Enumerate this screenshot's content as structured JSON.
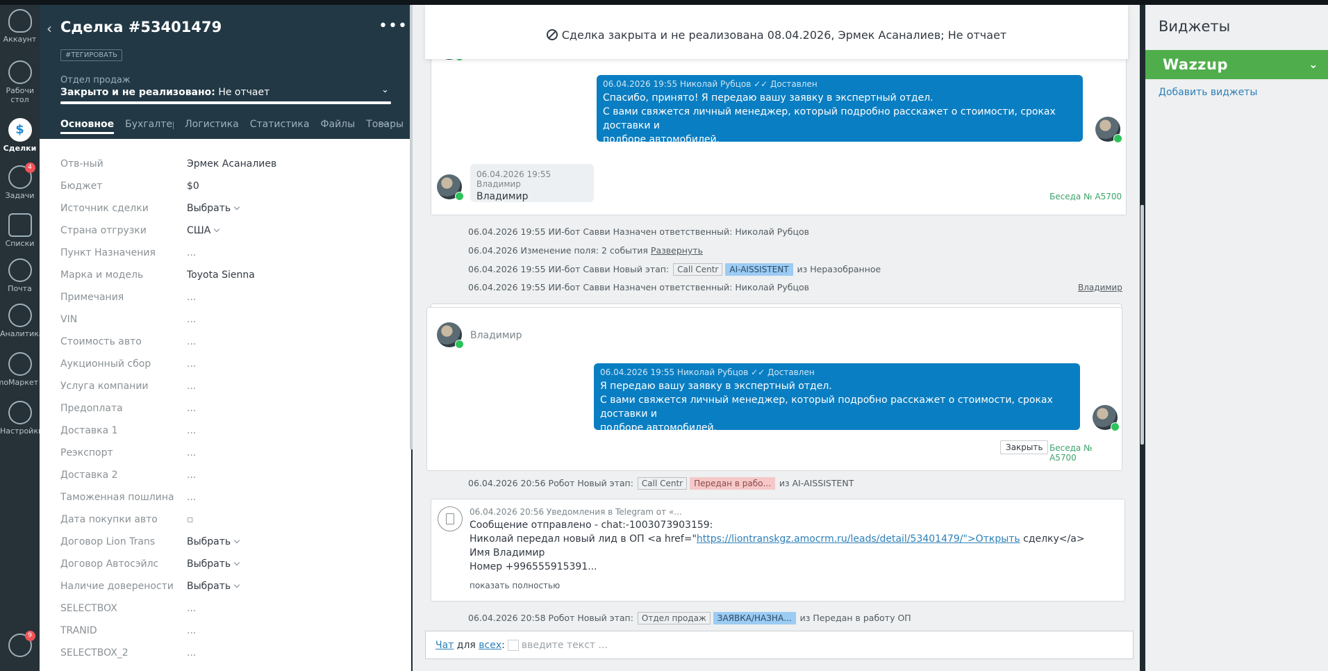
{
  "nav": {
    "items": [
      {
        "label": "Аккаунт",
        "icon": "account-icon"
      },
      {
        "label": "Рабочий стол",
        "icon": "dashboard-icon"
      },
      {
        "label": "Сделки",
        "icon": "deals-icon"
      },
      {
        "label": "Задачи",
        "icon": "tasks-icon",
        "badge": "4"
      },
      {
        "label": "Списки",
        "icon": "lists-icon"
      },
      {
        "label": "Почта",
        "icon": "mail-icon"
      },
      {
        "label": "Аналитика",
        "icon": "analytics-icon"
      },
      {
        "label": "amoМаркет",
        "icon": "market-icon"
      },
      {
        "label": "Настройки",
        "icon": "settings-icon"
      }
    ],
    "notifications_badge": "9"
  },
  "deal": {
    "title": "Сделка #53401479",
    "tag_button": "#ТЕГИРОВАТЬ",
    "department": "Отдел продаж",
    "status_bold": "Закрыто и не реализовано:",
    "status_reason": " Не отчает",
    "progress": 1.0,
    "tabs": [
      "Основное",
      "Бухгалтерия",
      "Логистика",
      "Статистика",
      "Файлы",
      "Товары"
    ],
    "fields": [
      {
        "label": "Отв-ный",
        "value": "Эрмек Асаналиев",
        "kind": "text"
      },
      {
        "label": "Бюджет",
        "value": "$0",
        "kind": "text"
      },
      {
        "label": "Источник сделки",
        "value": "Выбрать",
        "kind": "select"
      },
      {
        "label": "Страна отгрузки",
        "value": "США",
        "kind": "select"
      },
      {
        "label": "Пункт Назначения",
        "value": "...",
        "kind": "empty"
      },
      {
        "label": "Марка и модель",
        "value": "Toyota Sienna",
        "kind": "text"
      },
      {
        "label": "Примечания",
        "value": "...",
        "kind": "empty"
      },
      {
        "label": "VIN",
        "value": "...",
        "kind": "empty"
      },
      {
        "label": "Стоимость авто",
        "value": "...",
        "kind": "empty"
      },
      {
        "label": "Аукционный сбор",
        "value": "...",
        "kind": "empty"
      },
      {
        "label": "Услуга компании",
        "value": "...",
        "kind": "empty"
      },
      {
        "label": "Предоплата",
        "value": "...",
        "kind": "empty"
      },
      {
        "label": "Доставка 1",
        "value": "...",
        "kind": "empty"
      },
      {
        "label": "Реэкспорт",
        "value": "...",
        "kind": "empty"
      },
      {
        "label": "Доставка 2",
        "value": "...",
        "kind": "empty"
      },
      {
        "label": "Таможенная пошлина",
        "value": "...",
        "kind": "empty"
      },
      {
        "label": "Дата покупки авто",
        "value": "▫",
        "kind": "empty"
      },
      {
        "label": "Договор Lion Trans",
        "value": "Выбрать",
        "kind": "select"
      },
      {
        "label": "Договор Автосэйлс",
        "value": "Выбрать",
        "kind": "select"
      },
      {
        "label": "Наличие доверености",
        "value": "Выбрать",
        "kind": "select"
      },
      {
        "label": "SELECTBOX",
        "value": "...",
        "kind": "empty"
      },
      {
        "label": "TRANID",
        "value": "...",
        "kind": "empty"
      },
      {
        "label": "SELECTBOX_2",
        "value": "...",
        "kind": "empty"
      }
    ]
  },
  "feed": {
    "closed_banner": "Сделка закрыта и не реализована 08.04.2026, Эрмек Асаналиев; Не отчает",
    "msg1": {
      "meta": "06.04.2026 19:55 Николай Рубцов",
      "delivered": "✓✓ Доставлен",
      "lines": [
        "Спасибо, принято! Я передаю вашу заявку в экспертный отдел.",
        "С вами свяжется личный менеджер, который подробно расскажет о стоимости, сроках доставки и",
        "подборе автомобилей."
      ]
    },
    "msg2": {
      "meta": "06.04.2026 19:55 Владимир",
      "text": "Владимир"
    },
    "conversation_link": "Беседа № A5700",
    "sys1": "06.04.2026 19:55 ИИ-бот Савви Назначен ответственный: Николай Рубцов",
    "sys2_prefix": "06.04.2026 Изменение поля: 2 события ",
    "sys2_link": "Развернуть",
    "sys3_prefix": "06.04.2026 19:55 ИИ-бот Савви Новый этап:",
    "sys3_stage_a": "Call Centr",
    "sys3_stage_b": "AI-AISSISTENT",
    "sys3_suffix": "из Неразобранное",
    "sys4": "06.04.2026 19:55 ИИ-бот Савви Назначен ответственный: Николай Рубцов",
    "sys4_right": "Владимир",
    "conv2": {
      "name": "Владимир",
      "meta": "06.04.2026 19:55 Николай Рубцов",
      "delivered": "✓✓ Доставлен",
      "lines": [
        "Я передаю вашу заявку в экспертный отдел.",
        "С вами свяжется личный менеджер, который подробно расскажет о стоимости, сроках доставки и",
        "подборе автомобилей."
      ],
      "close_button": "Закрыть",
      "conversation_link": "Беседа № A5700"
    },
    "sys5_prefix": "06.04.2026 20:56 Робот Новый этап:",
    "sys5_stage_a": "Call Centr",
    "sys5_stage_b": "Передан в рабо...",
    "sys5_suffix": "из AI-AISSISTENT",
    "tg": {
      "meta": "06.04.2026 20:56 Уведомления в Telegram от «...",
      "line1": "Сообщение отправлено - chat:-1003073903159:",
      "line2_prefix": "Николай передал новый лид в ОП <a href=\"",
      "line2_link": "https://liontranskgz.amocrm.ru/leads/detail/53401479/\">Открыть",
      "line2_suffix": " сделку</a>",
      "line3": "Имя Владимир",
      "line4": "Номер +996555915391...",
      "more": "показать полностью"
    },
    "sys6_prefix": "06.04.2026 20:58 Робот Новый этап:",
    "sys6_stage_a": "Отдел продаж",
    "sys6_stage_b": "ЗАЯВКА/НАЗНА...",
    "sys6_suffix": "из Передан в работу ОП",
    "input": {
      "chat": "Чат",
      "for": " для ",
      "all": "всех",
      "colon": ":",
      "placeholder": "введите текст ..."
    }
  },
  "widgets": {
    "title": "Виджеты",
    "wazzup": "Wazzup",
    "add": "Добавить виджеты"
  }
}
